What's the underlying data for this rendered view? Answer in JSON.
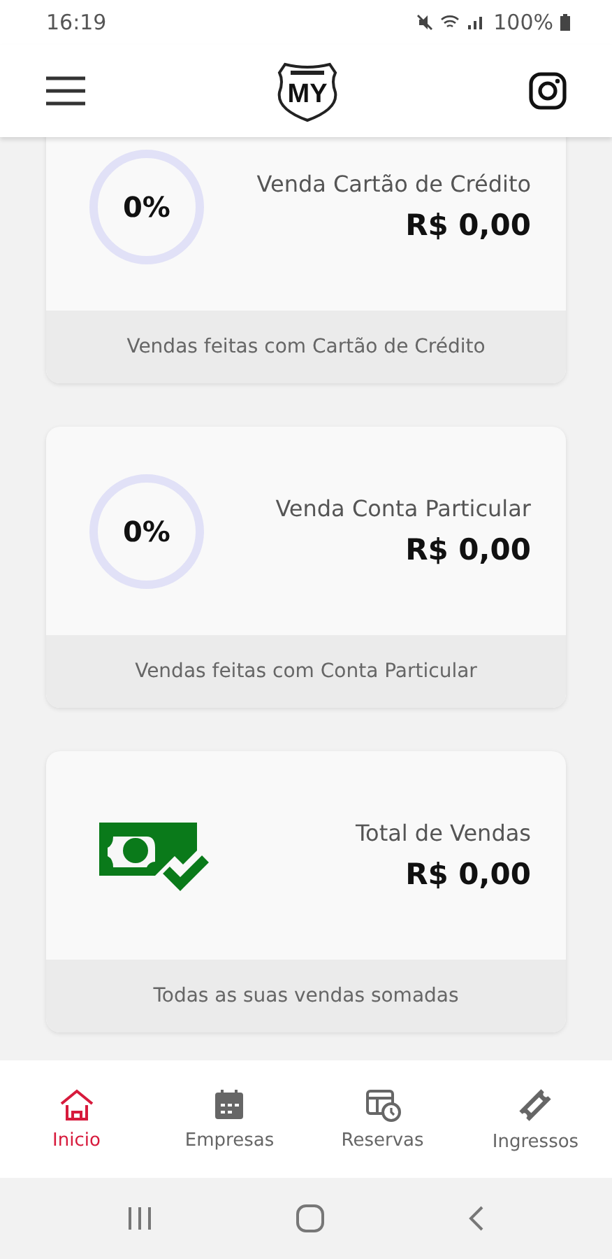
{
  "status_bar": {
    "time": "16:19",
    "battery": "100%"
  },
  "header": {
    "logo": "MY"
  },
  "cards": [
    {
      "kind": "ring",
      "percent": "0%",
      "level": 0,
      "title": "Venda Cartão de Crédito",
      "amount": "R$ 0,00",
      "footer": "Vendas feitas com Cartão de Crédito"
    },
    {
      "kind": "ring",
      "percent": "0%",
      "level": 0,
      "title": "Venda Conta Particular",
      "amount": "R$ 0,00",
      "footer": "Vendas feitas com Conta Particular"
    },
    {
      "kind": "money",
      "title": "Total de Vendas",
      "amount": "R$ 0,00",
      "footer": "Todas as suas vendas somadas"
    }
  ],
  "bottom_nav": [
    {
      "label": "Inicio",
      "selected": true
    },
    {
      "label": "Empresas",
      "selected": false
    },
    {
      "label": "Reservas",
      "selected": false
    },
    {
      "label": "Ingressos",
      "selected": false
    }
  ]
}
